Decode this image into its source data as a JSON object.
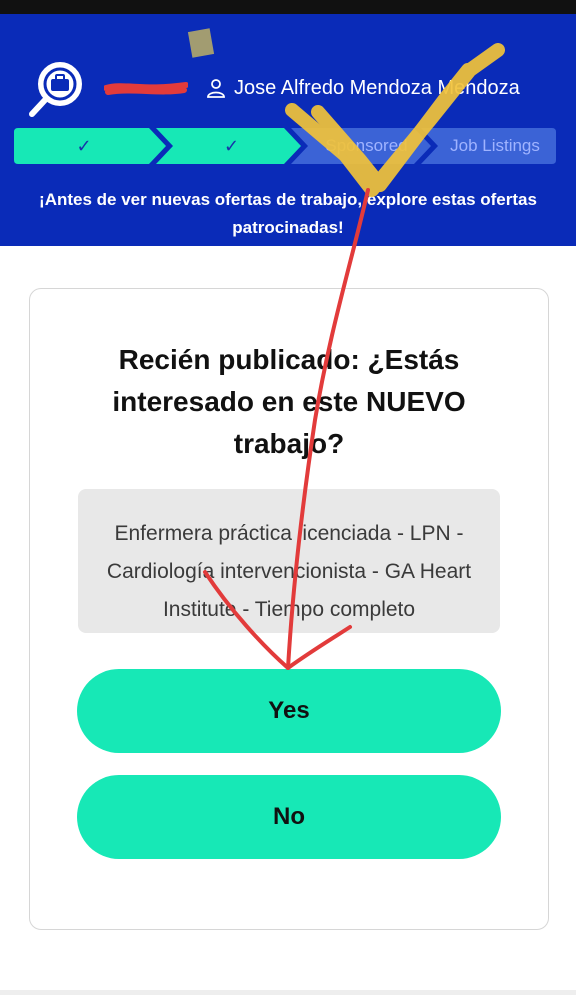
{
  "header": {
    "user_name": "Jose Alfredo Mendoza Mendoza",
    "progress_steps": [
      {
        "label": "✓",
        "state": "done"
      },
      {
        "label": "✓",
        "state": "done"
      },
      {
        "label": "Sponsored",
        "state": "current"
      },
      {
        "label": "Job Listings",
        "state": "pending"
      }
    ],
    "notice": "¡Antes de ver nuevas ofertas de trabajo, explore estas ofertas patrocinadas!"
  },
  "card": {
    "question": "Recién publicado: ¿Estás interesado en este NUEVO trabajo?",
    "job_title": "Enfermera práctica licenciada - LPN - Cardiología intervencionista - GA Heart Institute - Tiempo completo",
    "yes_label": "Yes",
    "no_label": "No"
  },
  "colors": {
    "header_bg": "#0a2bb8",
    "accent": "#17e8b6",
    "annotation_yellow": "#f2c33a",
    "annotation_red": "#e23b3b"
  }
}
